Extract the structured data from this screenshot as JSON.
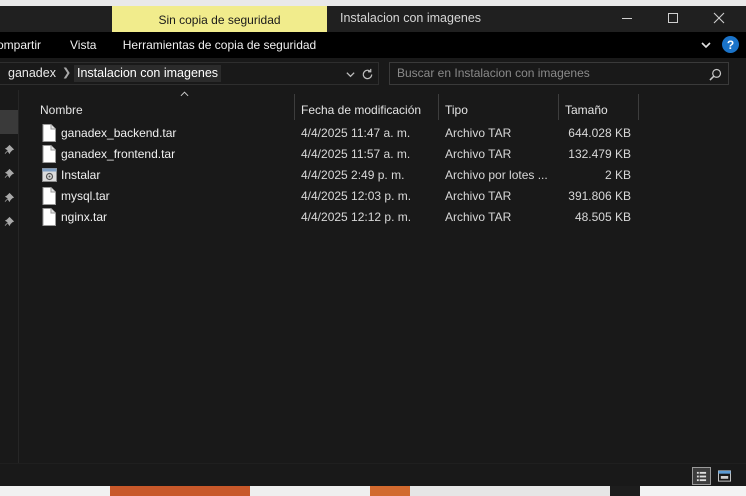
{
  "window": {
    "title": "Instalacion con imagenes",
    "context_tab": "Sin copia de seguridad"
  },
  "ribbon": {
    "tabs": [
      "ompartir",
      "Vista",
      "Herramientas de copia de seguridad"
    ]
  },
  "address": {
    "breadcrumb": [
      "ganadex",
      "Instalacion con imagenes"
    ],
    "search_placeholder": "Buscar en Instalacion con imagenes"
  },
  "columns": {
    "name": "Nombre",
    "date": "Fecha de modificación",
    "type": "Tipo",
    "size": "Tamaño"
  },
  "files": [
    {
      "name": "ganadex_backend.tar",
      "date": "4/4/2025 11:47 a. m.",
      "type": "Archivo TAR",
      "size": "644.028 KB",
      "icon": "file-icon"
    },
    {
      "name": "ganadex_frontend.tar",
      "date": "4/4/2025 11:57 a. m.",
      "type": "Archivo TAR",
      "size": "132.479 KB",
      "icon": "file-icon"
    },
    {
      "name": "Instalar",
      "date": "4/4/2025 2:49 p. m.",
      "type": "Archivo por lotes ...",
      "size": "2 KB",
      "icon": "batch-file-icon"
    },
    {
      "name": "mysql.tar",
      "date": "4/4/2025 12:03 p. m.",
      "type": "Archivo TAR",
      "size": "391.806 KB",
      "icon": "file-icon"
    },
    {
      "name": "nginx.tar",
      "date": "4/4/2025 12:12 p. m.",
      "type": "Archivo TAR",
      "size": "48.505 KB",
      "icon": "file-icon"
    }
  ],
  "colors": {
    "context_tab_bg": "#f1ec8c",
    "window_bg": "#191919",
    "help_blue": "#1a73c9"
  }
}
